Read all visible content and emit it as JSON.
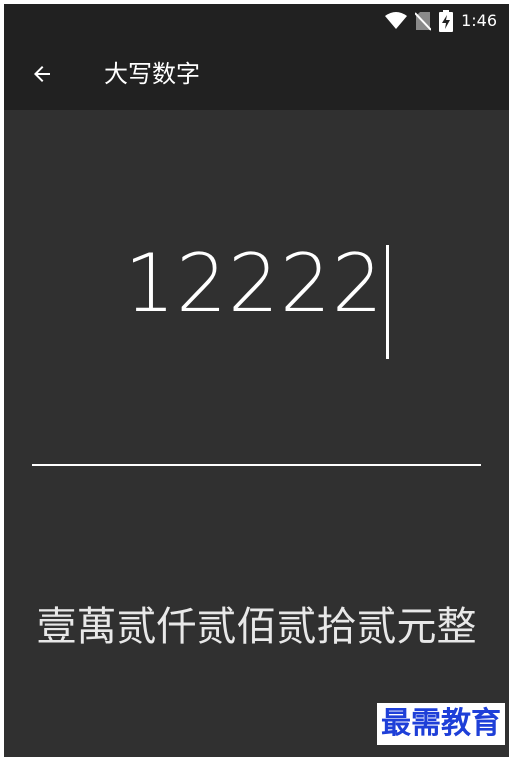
{
  "status_bar": {
    "time": "1:46",
    "icons": [
      "wifi-icon",
      "no-sim-icon",
      "battery-charging-icon"
    ]
  },
  "toolbar": {
    "back_icon": "arrow-left-icon",
    "title": "大写数字"
  },
  "number_input": {
    "value": "12222"
  },
  "result": {
    "text": "壹萬贰仟贰佰贰拾贰元整"
  },
  "watermark": {
    "text": "最需教育"
  },
  "colors": {
    "background": "#303030",
    "toolbar": "#212121",
    "text": "#ffffff",
    "watermark": "#1e3fd8"
  }
}
